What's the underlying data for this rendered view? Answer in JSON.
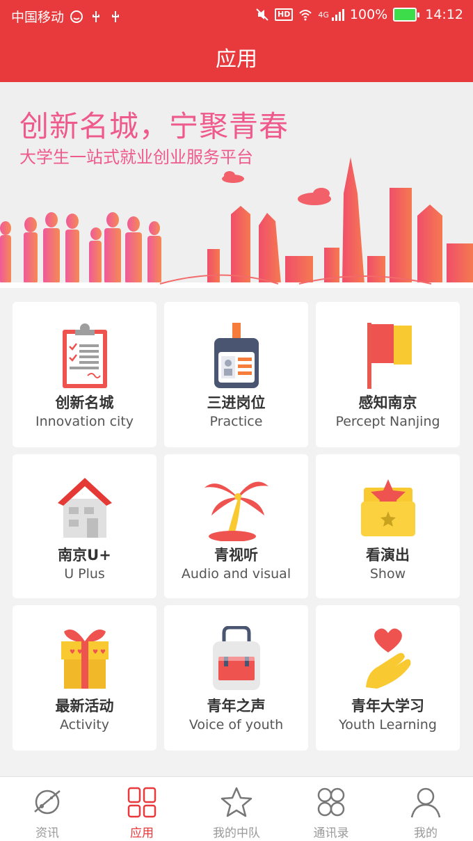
{
  "status_bar": {
    "carrier": "中国移动",
    "hd": "HD",
    "network": "4G",
    "battery": "100%",
    "time": "14:12"
  },
  "header": {
    "title": "应用"
  },
  "banner": {
    "slogan": "创新名城，宁聚青春",
    "subtitle": "大学生一站式就业创业服务平台"
  },
  "grid": [
    {
      "cn": "创新名城",
      "en": "Innovation city",
      "icon": "clipboard-icon"
    },
    {
      "cn": "三进岗位",
      "en": "Practice",
      "icon": "id-badge-icon"
    },
    {
      "cn": "感知南京",
      "en": "Percept Nanjing",
      "icon": "flag-icon"
    },
    {
      "cn": "南京U+",
      "en": "U Plus",
      "icon": "house-icon"
    },
    {
      "cn": "青视听",
      "en": "Audio and visual",
      "icon": "palm-tree-icon"
    },
    {
      "cn": "看演出",
      "en": "Show",
      "icon": "star-folder-icon"
    },
    {
      "cn": "最新活动",
      "en": "Activity",
      "icon": "gift-box-icon"
    },
    {
      "cn": "青年之声",
      "en": "Voice of youth",
      "icon": "bag-icon"
    },
    {
      "cn": "青年大学习",
      "en": "Youth Learning",
      "icon": "heart-hand-icon"
    }
  ],
  "tabs": [
    {
      "label": "资讯",
      "icon": "planet-icon",
      "active": false
    },
    {
      "label": "应用",
      "icon": "apps-grid-icon",
      "active": true
    },
    {
      "label": "我的中队",
      "icon": "star-icon",
      "active": false
    },
    {
      "label": "通讯录",
      "icon": "contacts-icon",
      "active": false
    },
    {
      "label": "我的",
      "icon": "user-icon",
      "active": false
    }
  ],
  "colors": {
    "primary": "#e8393c",
    "accent_pink": "#ef5a8d",
    "tab_inactive": "#999999"
  }
}
